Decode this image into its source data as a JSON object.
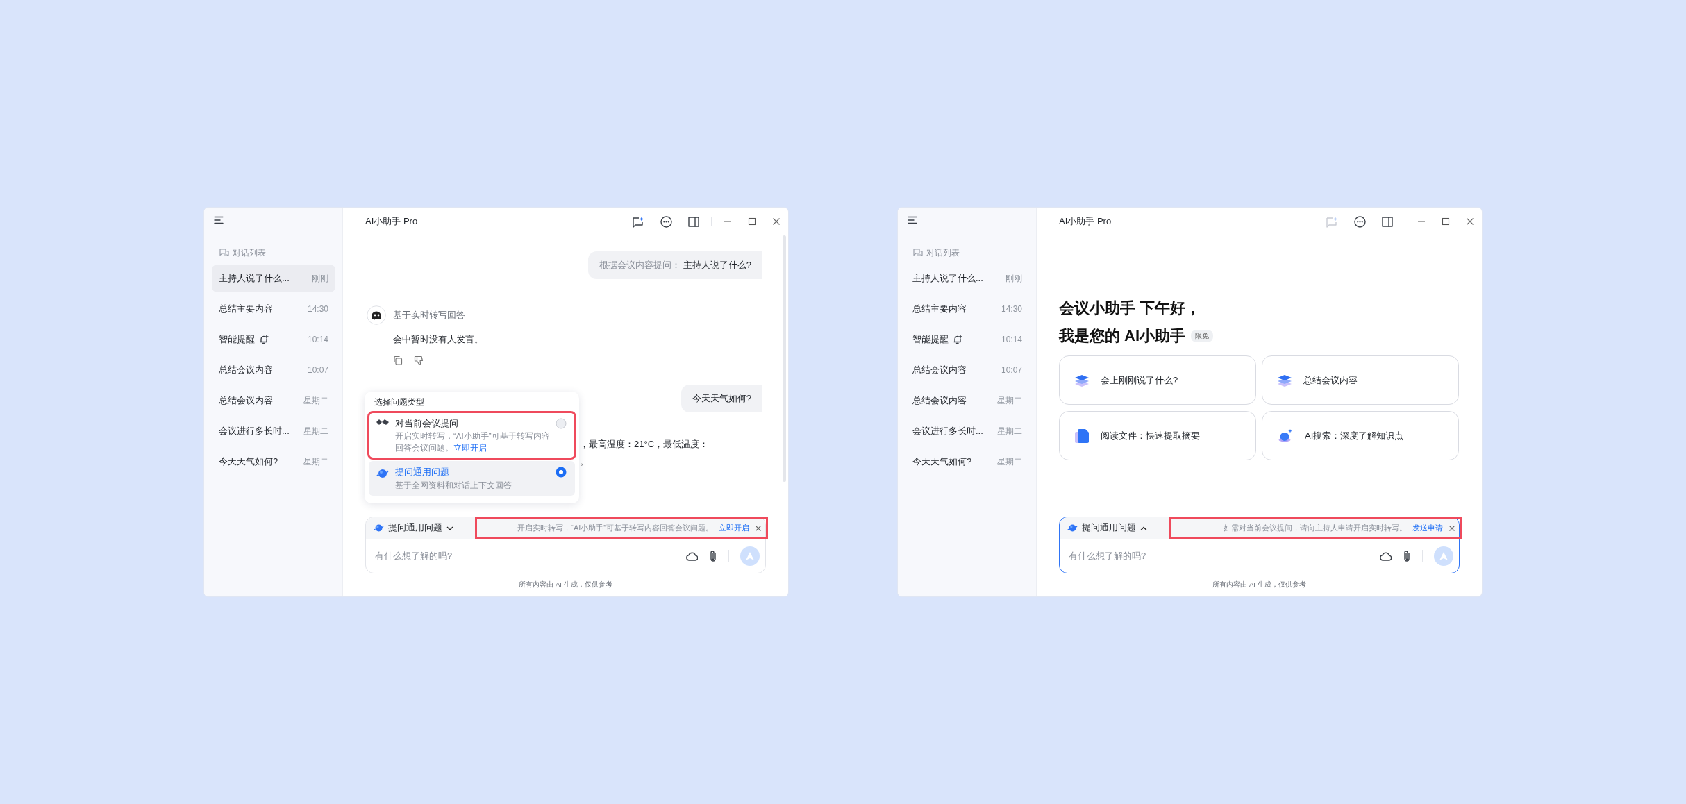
{
  "windows": [
    {
      "title": "AI小助手 Pro",
      "new_chat_disabled": false,
      "sidebar": {
        "header": "对话列表",
        "items": [
          {
            "kind": "plain",
            "title": "主持人说了什么...",
            "time": "刚刚",
            "selected": true
          },
          {
            "kind": "plain",
            "title": "总结主要内容",
            "time": "14:30",
            "selected": false
          },
          {
            "kind": "reminder",
            "title": "智能提醒",
            "time": "10:14",
            "selected": false
          },
          {
            "kind": "plain",
            "title": "总结会议内容",
            "time": "10:07",
            "selected": false
          },
          {
            "kind": "plain",
            "title": "总结会议内容",
            "time": "星期二",
            "selected": false
          },
          {
            "kind": "plain",
            "title": "会议进行多长时...",
            "time": "星期二",
            "selected": false
          },
          {
            "kind": "plain",
            "title": "今天天气如何?",
            "time": "星期二",
            "selected": false
          }
        ]
      },
      "content": {
        "kind": "chat",
        "messages": [
          {
            "kind": "user",
            "prefix": "根据会议内容提问：",
            "text": "主持人说了什么?"
          },
          {
            "kind": "bot",
            "source": "基于实时转写回答",
            "text": "会中暂时没有人发言。"
          },
          {
            "kind": "user",
            "text": "今天天气如何?"
          },
          {
            "kind": "partial",
            "lines": [
              "，最高温度：21°C，最低温度：",
              "。"
            ]
          }
        ],
        "popup": {
          "title": "选择问题类型",
          "options": [
            {
              "kind": "meeting",
              "title": "对当前会议提问",
              "description": "开启实时转写，“AI小助手”可基于转写内容回答会议问题。",
              "link": "立即开启",
              "selected": false,
              "highlighted": true
            },
            {
              "kind": "general",
              "title": "提问通用问题",
              "description": "基于全网资料和对话上下文回答",
              "selected": true,
              "highlighted": false
            }
          ]
        }
      },
      "composer": {
        "mode": "提问通用问题",
        "expanded": false,
        "focused": false,
        "notice": {
          "text": "开启实时转写，“AI小助手”可基于转写内容回答会议问题。",
          "link": "立即开启",
          "highlighted": true
        },
        "placeholder": "有什么想了解的吗?"
      },
      "footer": "所有内容由 AI 生成，仅供参考"
    },
    {
      "title": "AI小助手 Pro",
      "new_chat_disabled": true,
      "sidebar": {
        "header": "对话列表",
        "items": [
          {
            "kind": "plain",
            "title": "主持人说了什么...",
            "time": "刚刚",
            "selected": false
          },
          {
            "kind": "plain",
            "title": "总结主要内容",
            "time": "14:30",
            "selected": false
          },
          {
            "kind": "reminder",
            "title": "智能提醒",
            "time": "10:14",
            "selected": false
          },
          {
            "kind": "plain",
            "title": "总结会议内容",
            "time": "10:07",
            "selected": false
          },
          {
            "kind": "plain",
            "title": "总结会议内容",
            "time": "星期二",
            "selected": false
          },
          {
            "kind": "plain",
            "title": "会议进行多长时...",
            "time": "星期二",
            "selected": false
          },
          {
            "kind": "plain",
            "title": "今天天气如何?",
            "time": "星期二",
            "selected": false
          }
        ]
      },
      "content": {
        "kind": "welcome",
        "greeting": "会议小助手 下午好，",
        "headline": "我是您的 AI小助手",
        "badge": "限免",
        "cards": [
          {
            "kind": "layers",
            "text": "会上刚刚说了什么?"
          },
          {
            "kind": "layers",
            "text": "总结会议内容"
          },
          {
            "kind": "document",
            "text": "阅读文件：快速提取摘要"
          },
          {
            "kind": "planet",
            "text": "AI搜索：深度了解知识点"
          }
        ]
      },
      "composer": {
        "mode": "提问通用问题",
        "expanded": true,
        "focused": true,
        "notice": {
          "text": "如需对当前会议提问，请向主持人申请开启实时转写。",
          "link": "发送申请",
          "highlighted": true
        },
        "placeholder": "有什么想了解的吗?"
      },
      "footer": "所有内容由 AI 生成，仅供参考"
    }
  ]
}
